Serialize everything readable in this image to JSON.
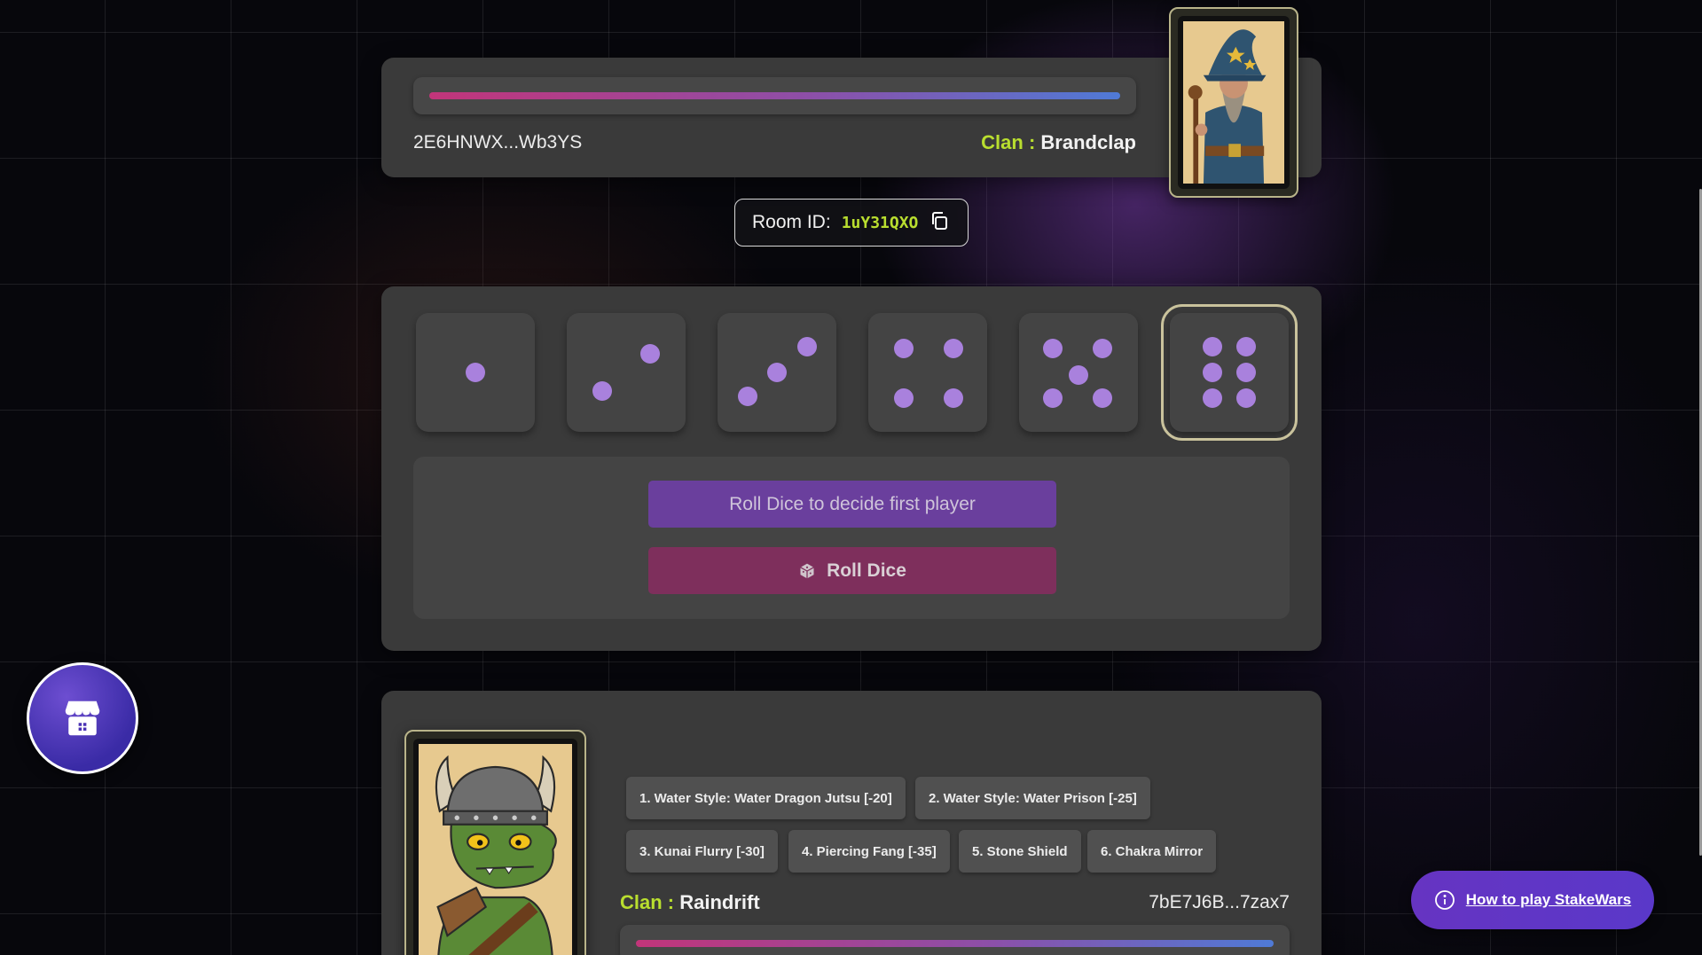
{
  "opponent": {
    "wallet": "2E6HNWX...Wb3YS",
    "clan_label": "Clan :",
    "clan_name": "Brandclap",
    "hp_fraction": 1.0,
    "avatar": "wizard-avatar"
  },
  "room": {
    "label": "Room ID:",
    "id": "1uY31QXO",
    "copy_icon": "copy-icon"
  },
  "dice": {
    "faces": [
      1,
      2,
      3,
      4,
      5,
      6
    ],
    "selected_face": 6,
    "pip_color": "#a981dd"
  },
  "status_text": "Roll Dice to decide first player",
  "roll_button_label": "Roll Dice",
  "player": {
    "avatar": "dragon-warrior-avatar",
    "skills": [
      "1. Water Style: Water Dragon Jutsu [-20]",
      "2. Water Style: Water Prison [-25]",
      "3. Kunai Flurry [-30]",
      "4. Piercing Fang [-35]",
      "5. Stone Shield",
      "6. Chakra Mirror"
    ],
    "clan_label": "Clan :",
    "clan_name": "Raindrift",
    "wallet": "7bE7J6B...7zax7",
    "hp_fraction": 1.0
  },
  "shop_icon": "shop-icon",
  "help": {
    "icon": "info-icon",
    "link_text": "How to play StakeWars"
  },
  "colors": {
    "accent_green": "#b9de2f",
    "panel": "#3a3a3a",
    "status_purple": "#6a3f9d",
    "roll_magenta": "#7e2f5c",
    "help_purple": "#6634c2"
  }
}
